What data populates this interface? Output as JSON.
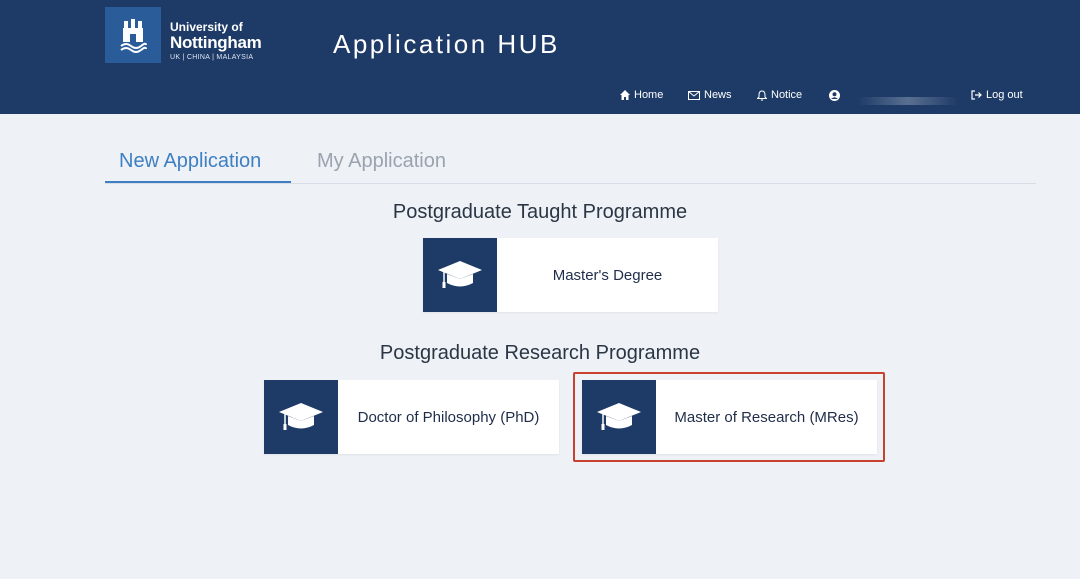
{
  "header": {
    "logo": {
      "line1": "University of",
      "line2": "Nottingham",
      "line3": "UK | CHINA | MALAYSIA"
    },
    "title": "Application HUB",
    "nav": {
      "home": "Home",
      "news": "News",
      "notice": "Notice",
      "logout": "Log out"
    }
  },
  "tabs": {
    "new": "New Application",
    "my": "My Application"
  },
  "sections": {
    "taught": "Postgraduate Taught Programme",
    "research": "Postgraduate Research Programme"
  },
  "cards": {
    "masters": "Master's Degree",
    "phd": "Doctor of Philosophy (PhD)",
    "mres": "Master of Research (MRes)"
  },
  "colors": {
    "header_bg": "#1e3b67",
    "active_tab": "#3e7fc3",
    "highlight_border": "#c8402e"
  },
  "icons": [
    "home-icon",
    "envelope-icon",
    "bell-icon",
    "user-icon",
    "logout-icon",
    "graduation-cap-icon"
  ]
}
